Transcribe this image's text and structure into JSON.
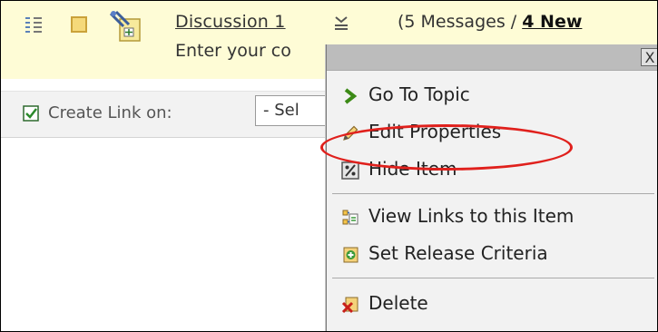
{
  "topic": {
    "title": "Discussion 1",
    "messages_open": "(5 Messages / ",
    "new_count": "4 New",
    "description": "Enter your co"
  },
  "toolbar": {
    "create_link_label": "Create Link on:",
    "select_value": "- Sel"
  },
  "menu": {
    "close_label": "X",
    "items": [
      {
        "label": "Go To Topic",
        "icon": "green-arrow-icon"
      },
      {
        "label": "Edit Properties",
        "icon": "pencil-icon"
      },
      {
        "label": "Hide Item",
        "icon": "hide-item-icon"
      },
      {
        "label": "View Links to this Item",
        "icon": "view-links-icon"
      },
      {
        "label": "Set Release Criteria",
        "icon": "release-criteria-icon"
      },
      {
        "label": "Delete",
        "icon": "delete-icon"
      }
    ]
  },
  "annotation": {
    "highlight_color": "#e0201c",
    "highlighted_item": "Edit Properties"
  },
  "colors": {
    "header_bg": "#fefcd6",
    "toolbar_bg": "#f2f2f2",
    "menu_bg": "#f2f2f2",
    "menu_titlebar": "#bcbcbc",
    "go_arrow": "#3c8a16"
  }
}
